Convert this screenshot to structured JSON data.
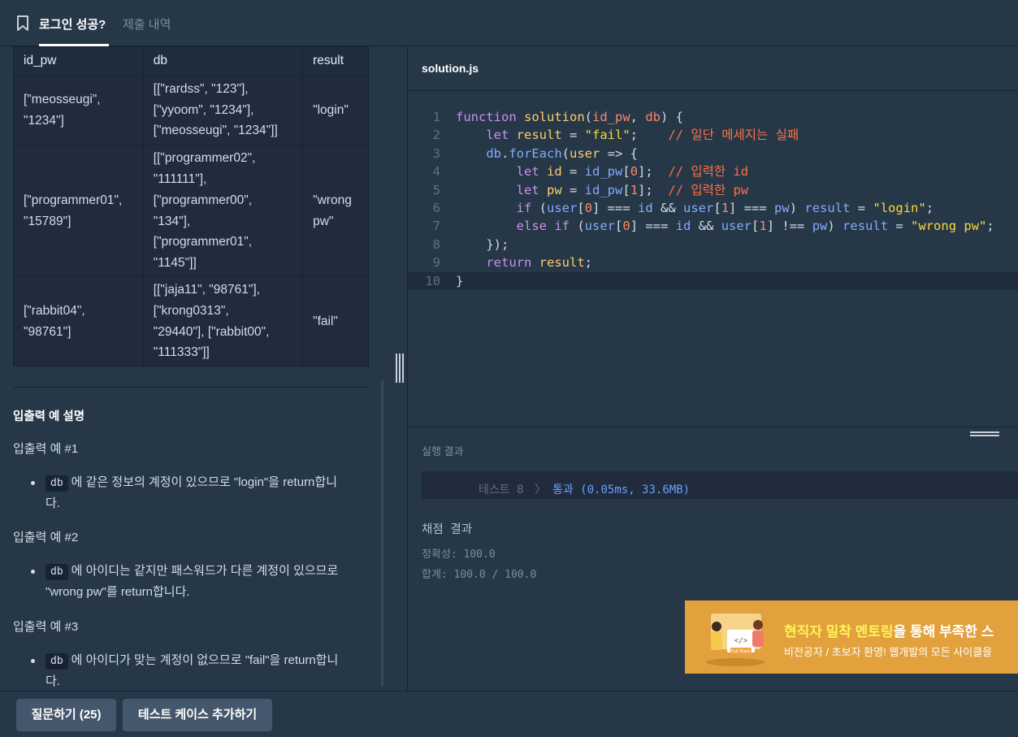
{
  "header": {
    "tabs": [
      {
        "label": "로그인 성공?",
        "active": true
      },
      {
        "label": "제출 내역",
        "active": false
      }
    ]
  },
  "io_table": {
    "headers": [
      "id_pw",
      "db",
      "result"
    ],
    "rows": [
      {
        "id_pw": [
          "[\"meosseugi\",",
          "\"1234\"]"
        ],
        "db": [
          "[[\"rardss\", \"123\"],",
          "[\"yyoom\", \"1234\"],",
          "[\"meosseugi\", \"1234\"]]"
        ],
        "result": [
          "\"login\""
        ]
      },
      {
        "id_pw": [
          "[\"programmer01\",",
          "\"15789\"]"
        ],
        "db": [
          "[[\"programmer02\",",
          "\"111111\"],",
          "[\"programmer00\",",
          "\"134\"],",
          "[\"programmer01\",",
          "\"1145\"]]"
        ],
        "result": [
          "\"wrong",
          "pw\""
        ]
      },
      {
        "id_pw": [
          "[\"rabbit04\",",
          "\"98761\"]"
        ],
        "db": [
          "[[\"jaja11\", \"98761\"],",
          "[\"krong0313\",",
          "\"29440\"], [\"rabbit00\",",
          "\"111333\"]]"
        ],
        "result": [
          "\"fail\""
        ]
      }
    ]
  },
  "explanation": {
    "title": "입출력 예 설명",
    "examples": [
      {
        "heading": "입출력 예 #1",
        "code": "db",
        "text_lines": [
          "에 같은 정보의 계정이 있으므로 \"login\"을 return합니",
          "다."
        ]
      },
      {
        "heading": "입출력 예 #2",
        "code": "db",
        "text_lines": [
          "에 아이디는 같지만 패스워드가 다른 계정이 있으므로",
          "\"wrong pw\"를 return합니다."
        ]
      },
      {
        "heading": "입출력 예 #3",
        "code": "db",
        "text_lines": [
          "에 아이디가 맞는 계정이 없으므로 \"fail\"을 return합니",
          "다."
        ]
      }
    ]
  },
  "editor": {
    "filename": "solution.js",
    "line_numbers": [
      "1",
      "2",
      "3",
      "4",
      "5",
      "6",
      "7",
      "8",
      "9",
      "10"
    ],
    "current_line": 10
  },
  "result": {
    "title": "실행 결과",
    "test_label": "테스트 8",
    "test_arrow": "〉",
    "test_result": "통과 (0.05ms, 33.6MB)",
    "score_title": "채점 결과",
    "accuracy": "정확성: 100.0",
    "total": "합계: 100.0 / 100.0"
  },
  "ad": {
    "main_prefix": "현직자 밀착 멘토링",
    "main_suffix": "을 통해 부족한 스",
    "sub": "비전공자 / 초보자 환영! 웹개발의 모든 사이클을",
    "badge": "Full Stack",
    "colors": {
      "background": "#e2a13c",
      "highlight": "#fff35c"
    }
  },
  "footer": {
    "ask_button": "질문하기 (25)",
    "add_testcase_button": "테스트 케이스 추가하기"
  },
  "colors": {
    "background": "#263747",
    "panel_dark": "#202b3d",
    "border": "#172334",
    "button": "#44576c",
    "pass_text": "#6ba0ff"
  }
}
